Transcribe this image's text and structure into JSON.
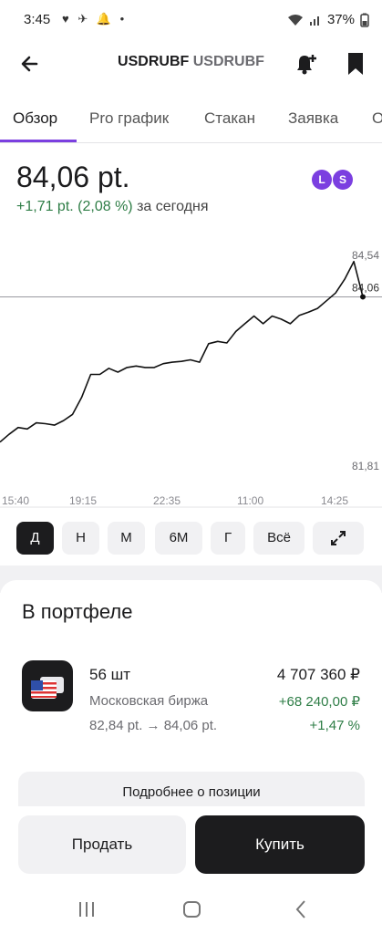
{
  "status": {
    "time": "3:45",
    "battery": "37%"
  },
  "header": {
    "ticker": "USDRUBF",
    "ticker_sub": "USDRUBF"
  },
  "tabs": [
    {
      "label": "Обзор",
      "active": true
    },
    {
      "label": "Pro график",
      "active": false
    },
    {
      "label": "Стакан",
      "active": false
    },
    {
      "label": "Заявка",
      "active": false
    },
    {
      "label": "О",
      "active": false
    }
  ],
  "quote": {
    "price": "84,06 pt.",
    "change": "+1,71 pt. (2,08 %)",
    "change_period": "за сегодня",
    "badges": [
      "L",
      "S"
    ]
  },
  "chart_data": {
    "type": "line",
    "y_labels": [
      "84,54",
      "84,06",
      "81,81"
    ],
    "x_labels": [
      "15:40",
      "19:15",
      "22:35",
      "11:00",
      "14:25"
    ],
    "ylim": [
      81.81,
      84.54
    ],
    "current": 84.06,
    "series": [
      {
        "values": [
          82.17,
          82.27,
          82.36,
          82.34,
          82.42,
          82.41,
          82.39,
          82.45,
          82.53,
          82.75,
          83.05,
          83.05,
          83.13,
          83.08,
          83.14,
          83.16,
          83.14,
          83.14,
          83.19,
          83.21,
          83.22,
          83.24,
          83.21,
          83.45,
          83.48,
          83.46,
          83.61,
          83.71,
          83.81,
          83.71,
          83.81,
          83.77,
          83.71,
          83.82,
          83.86,
          83.91,
          84.01,
          84.11,
          84.29,
          84.52,
          84.06
        ]
      }
    ]
  },
  "periods": [
    {
      "label": "Д",
      "active": true
    },
    {
      "label": "Н",
      "active": false
    },
    {
      "label": "М",
      "active": false
    },
    {
      "label": "6М",
      "active": false
    },
    {
      "label": "Г",
      "active": false
    },
    {
      "label": "Всё",
      "active": false
    }
  ],
  "portfolio": {
    "title": "В портфеле",
    "qty": "56 шт",
    "exchange": "Московская биржа",
    "range": "82,84 pt. → 84,06 pt.",
    "total": "4 707 360 ₽",
    "profit": "+68 240,00 ₽",
    "profit_pct": "+1,47 %",
    "details_label": "Подробнее о позиции"
  },
  "actions": {
    "sell": "Продать",
    "buy": "Купить"
  },
  "colors": {
    "accent": "#7b3fe0",
    "positive": "#2e7d46",
    "dark": "#1c1c1e",
    "light_bg": "#f1f1f3"
  }
}
